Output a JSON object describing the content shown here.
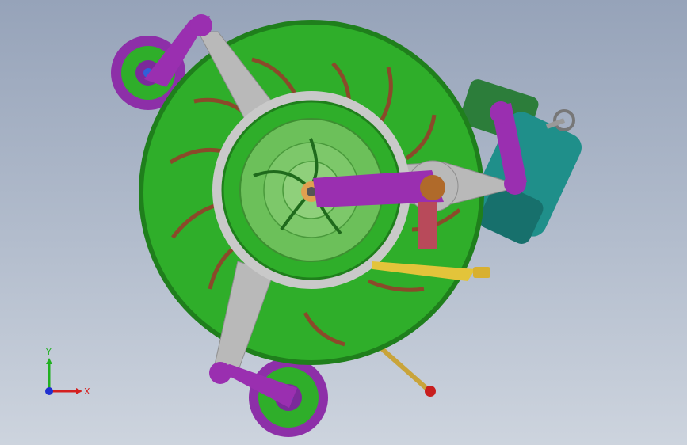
{
  "viewport": {
    "background_top": "#96a3b9",
    "background_bottom": "#cdd4de"
  },
  "model": {
    "colors": {
      "wheel_green": "#2fae2a",
      "wheel_dark": "#1f7f1c",
      "hub_green": "#5fbf4b",
      "blade_brown": "#8a4a2a",
      "arm_purple": "#9a2fb0",
      "spider_grey": "#b8b8b8",
      "motor_teal": "#1f8f8a",
      "shaft_brass": "#c9a43a",
      "handle_red": "#c81e1e"
    }
  },
  "triad": {
    "x_label": "X",
    "y_label": "Y",
    "x_color": "#d42020",
    "y_color": "#20b020",
    "z_color": "#2030d0"
  }
}
